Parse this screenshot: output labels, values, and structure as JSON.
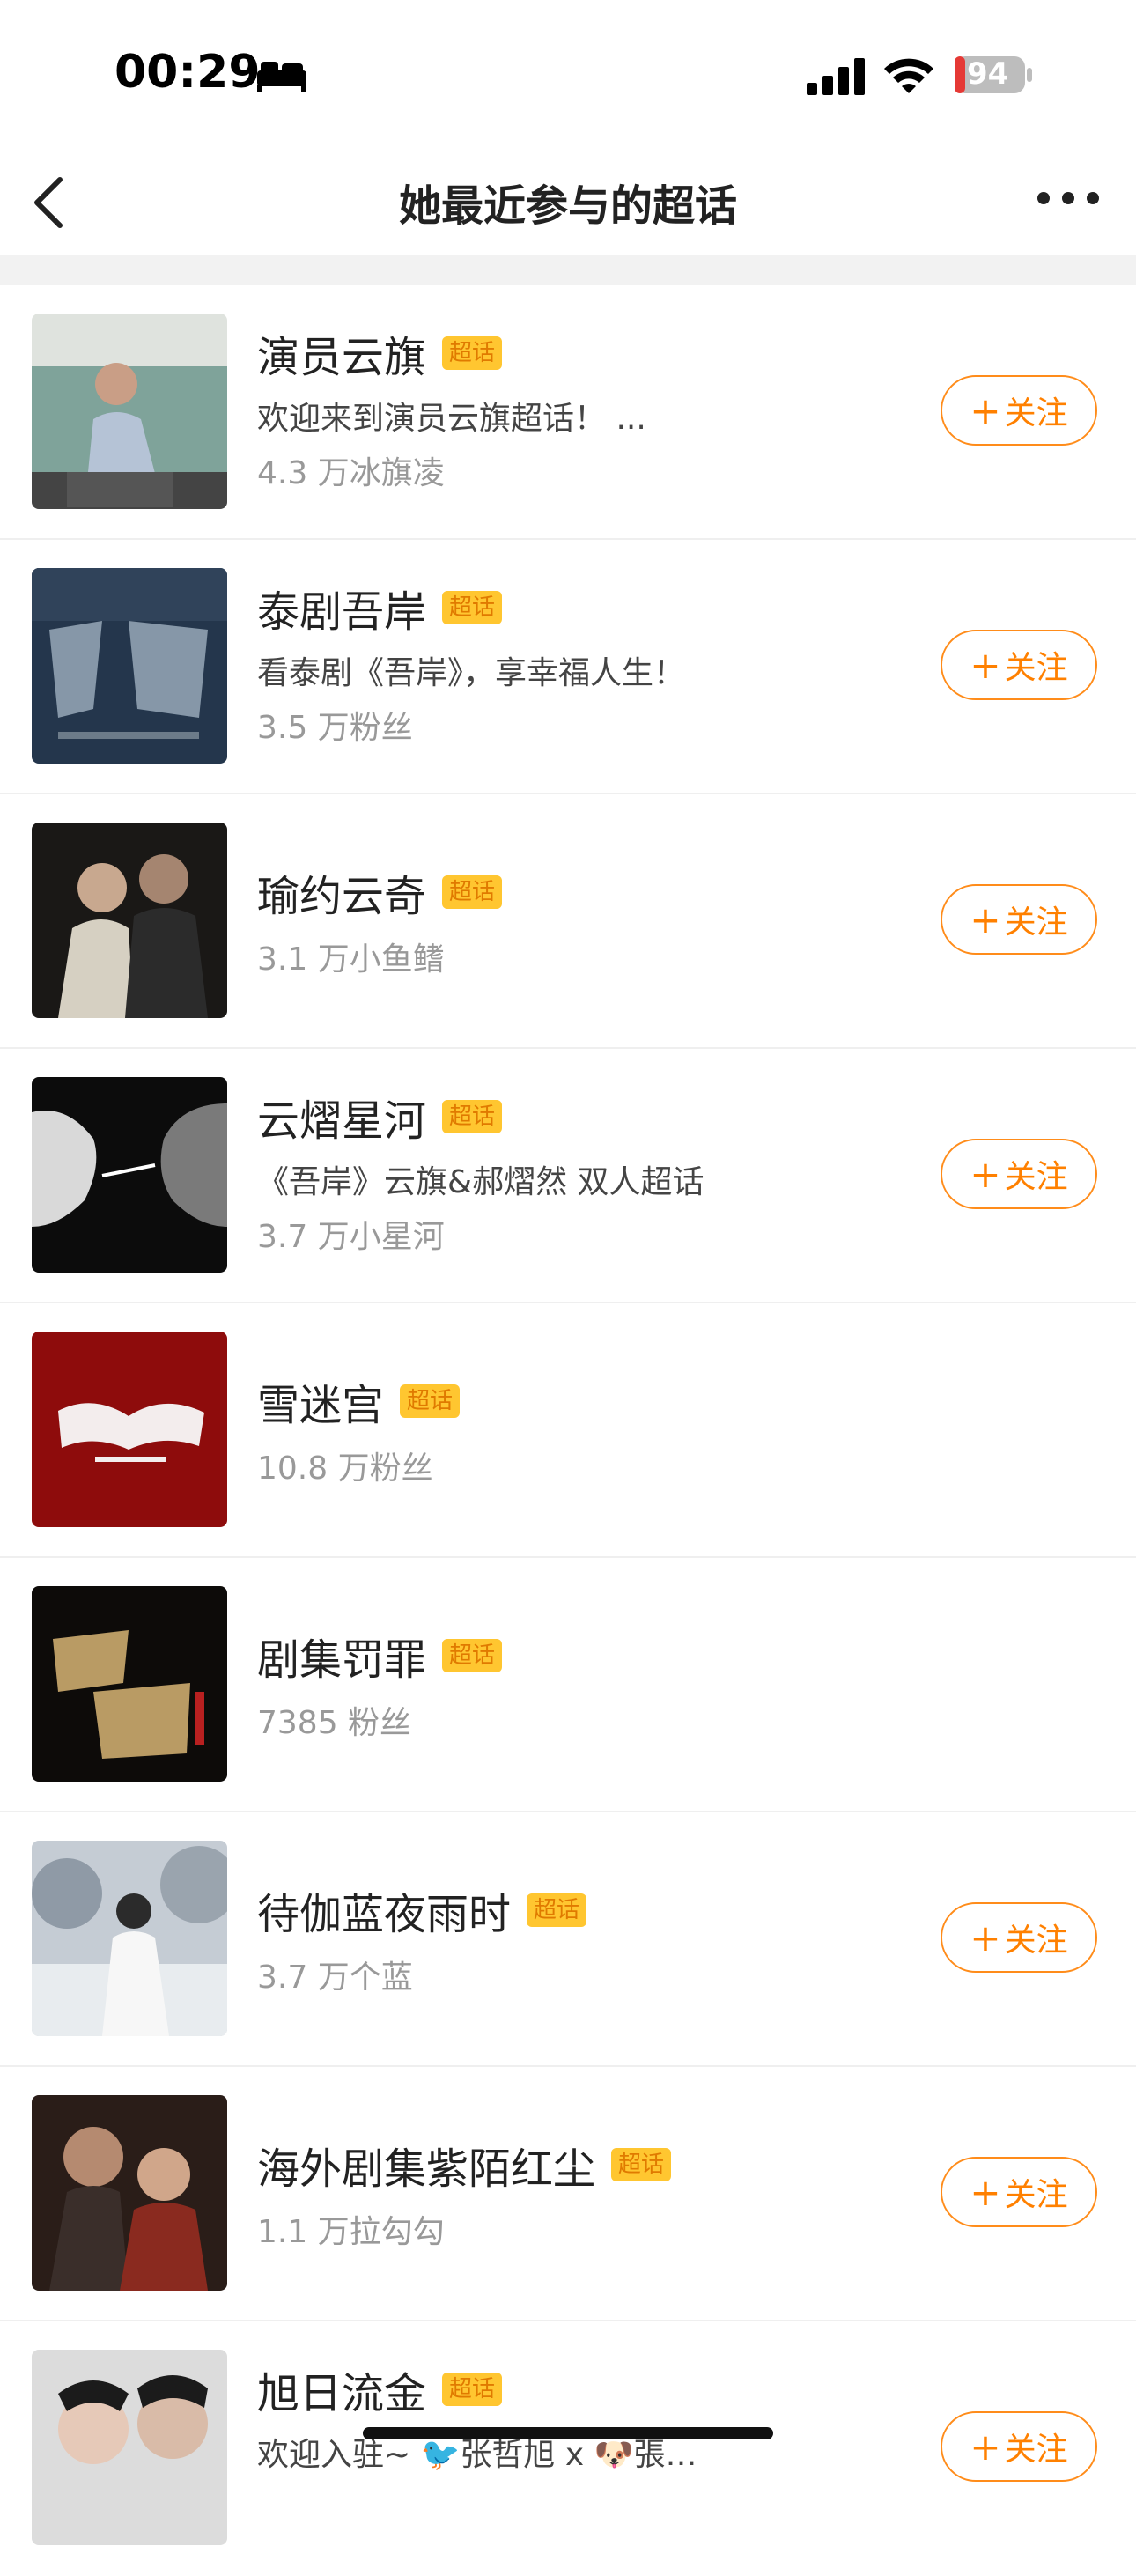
{
  "status_bar": {
    "time": "00:29",
    "battery": "94"
  },
  "nav": {
    "title": "她最近参与的超话"
  },
  "badge_label": "超话",
  "follow_label": "关注",
  "items": [
    {
      "title": "演员云旗",
      "desc": "欢迎来到演员云旗超话！ ...",
      "fans": "4.3 万冰旗凌",
      "follow": true,
      "thumb": "portrait-man-sitting"
    },
    {
      "title": "泰剧吾岸",
      "desc": "看泰剧《吾岸》，享幸福人生！",
      "fans": "3.5 万粉丝",
      "follow": true,
      "thumb": "poster-wuan"
    },
    {
      "title": "瑜约云奇",
      "desc": "",
      "fans": "3.1 万小鱼鳍",
      "follow": true,
      "thumb": "two-men-photo"
    },
    {
      "title": "云熠星河",
      "desc": "《吾岸》云旗&郝熠然 双人超话",
      "fans": "3.7 万小星河",
      "follow": true,
      "thumb": "two-faces-dark"
    },
    {
      "title": "雪迷宫",
      "desc": "",
      "fans": "10.8 万粉丝",
      "follow": false,
      "thumb": "poster-xuemigong"
    },
    {
      "title": "剧集罚罪",
      "desc": "",
      "fans": "7385 粉丝",
      "follow": false,
      "thumb": "poster-fazui"
    },
    {
      "title": "待伽蓝夜雨时",
      "desc": "",
      "fans": "3.7 万个蓝",
      "follow": true,
      "thumb": "woman-white-dress"
    },
    {
      "title": "海外剧集紫陌红尘",
      "desc": "",
      "fans": "1.1 万拉勾勾",
      "follow": true,
      "thumb": "costume-couple"
    },
    {
      "title": "旭日流金",
      "desc": "欢迎入驻~ 🐦张哲旭 x 🐶張金 cp超话",
      "fans": "",
      "follow": true,
      "thumb": "two-men-portrait"
    }
  ]
}
